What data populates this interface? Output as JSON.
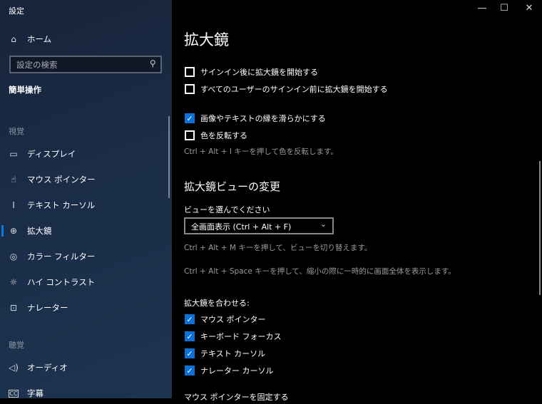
{
  "window": {
    "title": "設定",
    "minimize": "—",
    "maximize": "☐",
    "close": "✕"
  },
  "sidebar": {
    "home": "ホーム",
    "search_placeholder": "設定の検索",
    "category": "簡単操作",
    "section_vision": "視覚",
    "section_hearing": "聴覚",
    "items": [
      {
        "label": "ディスプレイ",
        "icon": "monitor-icon"
      },
      {
        "label": "マウス ポインター",
        "icon": "mouse-pointer-icon"
      },
      {
        "label": "テキスト カーソル",
        "icon": "text-cursor-icon"
      },
      {
        "label": "拡大鏡",
        "icon": "magnifier-icon",
        "selected": true
      },
      {
        "label": "カラー フィルター",
        "icon": "palette-icon"
      },
      {
        "label": "ハイ コントラスト",
        "icon": "brightness-icon"
      },
      {
        "label": "ナレーター",
        "icon": "narrator-icon"
      },
      {
        "label": "オーディオ",
        "icon": "speaker-icon"
      },
      {
        "label": "字幕",
        "icon": "captions-icon"
      }
    ]
  },
  "main": {
    "title": "拡大鏡",
    "cb1": {
      "label": "サインイン後に拡大鏡を開始する",
      "checked": false
    },
    "cb2": {
      "label": "すべてのユーザーのサインイン前に拡大鏡を開始する",
      "checked": false
    },
    "cb3": {
      "label": "画像やテキストの縁を滑らかにする",
      "checked": true
    },
    "cb4": {
      "label": "色を反転する",
      "checked": false
    },
    "invert_hint": "Ctrl + Alt + I キーを押して色を反転します。",
    "view_heading": "拡大鏡ビューの変更",
    "view_label": "ビューを選んでください",
    "view_value": "全画面表示 (Ctrl + Alt + F)",
    "hint_m": "Ctrl + Alt + M キーを押して、ビューを切り替えます。",
    "hint_space": "Ctrl + Alt + Space キーを押して、縮小の際に一時的に画面全体を表示します。",
    "follow_label": "拡大鏡を合わせる:",
    "follow": [
      {
        "label": "マウス ポインター",
        "checked": true
      },
      {
        "label": "キーボード フォーカス",
        "checked": true
      },
      {
        "label": "テキスト カーソル",
        "checked": true
      },
      {
        "label": "ナレーター カーソル",
        "checked": true
      }
    ],
    "lock_label": "マウス ポインターを固定する"
  }
}
